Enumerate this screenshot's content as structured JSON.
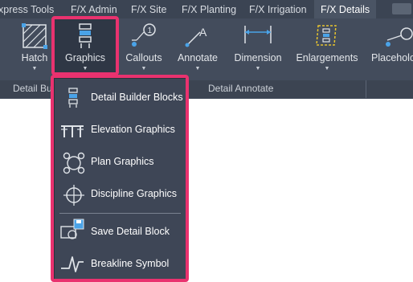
{
  "tabs": [
    {
      "label": "xpress Tools",
      "active": false
    },
    {
      "label": "F/X Admin",
      "active": false
    },
    {
      "label": "F/X Site",
      "active": false
    },
    {
      "label": "F/X Planting",
      "active": false
    },
    {
      "label": "F/X Irrigation",
      "active": false
    },
    {
      "label": "F/X Details",
      "active": true
    }
  ],
  "ribbon": {
    "buttons": [
      {
        "label": "Hatch",
        "icon": "hatch-icon"
      },
      {
        "label": "Graphics",
        "icon": "graphics-icon"
      },
      {
        "label": "Callouts",
        "icon": "callouts-icon"
      },
      {
        "label": "Annotate",
        "icon": "annotate-icon"
      },
      {
        "label": "Dimension",
        "icon": "dimension-icon"
      },
      {
        "label": "Enlargements",
        "icon": "enlargements-icon"
      },
      {
        "label": "Placeholo",
        "icon": "placeholder-icon"
      }
    ],
    "groups": [
      {
        "label": "Detail Bu"
      },
      {
        "label": "Detail Annotate"
      }
    ]
  },
  "dropdown": {
    "items": [
      {
        "label": "Detail Builder Blocks",
        "icon": "detail-builder-blocks-icon"
      },
      {
        "label": "Elevation Graphics",
        "icon": "elevation-graphics-icon"
      },
      {
        "label": "Plan Graphics",
        "icon": "plan-graphics-icon"
      },
      {
        "label": "Discipline Graphics",
        "icon": "discipline-graphics-icon"
      },
      {
        "label": "Save Detail Block",
        "icon": "save-detail-block-icon"
      },
      {
        "label": "Breakline Symbol",
        "icon": "breakline-symbol-icon"
      }
    ]
  },
  "colors": {
    "highlight": "#e9326f",
    "ribbon": "#434c5c",
    "tab_bar": "#3b4453",
    "menu": "#3e4656",
    "accent_blue": "#4aa3e8"
  }
}
